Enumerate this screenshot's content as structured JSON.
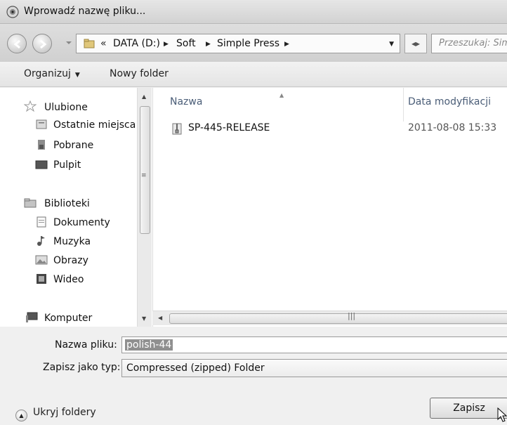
{
  "window": {
    "title": "Wprowadź nazwę pliku..."
  },
  "address": {
    "overflow": "«",
    "crumbs": [
      "DATA (D:)",
      "Soft",
      "Simple Press"
    ],
    "search_placeholder": "Przeszukaj: Sim"
  },
  "toolbar": {
    "organize_label": "Organizuj",
    "new_folder_label": "Nowy folder"
  },
  "nav": {
    "favorites_label": "Ulubione",
    "favorites": [
      "Ostatnie miejsca",
      "Pobrane",
      "Pulpit"
    ],
    "libraries_label": "Biblioteki",
    "libraries": [
      "Dokumenty",
      "Muzyka",
      "Obrazy",
      "Wideo"
    ],
    "computer_label": "Komputer"
  },
  "files": {
    "columns": {
      "name": "Nazwa",
      "modified": "Data modyfikacji"
    },
    "rows": [
      {
        "name": "SP-445-RELEASE",
        "modified": "2011-08-08 15:33"
      }
    ]
  },
  "form": {
    "filename_label": "Nazwa pliku:",
    "filename_value": "polish-44",
    "type_label": "Zapisz jako typ:",
    "type_value": "Compressed (zipped) Folder",
    "hide_folders_label": "Ukryj foldery",
    "save_label": "Zapisz"
  },
  "icons": {
    "app": "dialog-icon",
    "back": "back-arrow-icon",
    "forward": "forward-arrow-icon",
    "refresh": "refresh-icon",
    "favorites": "star-icon",
    "folder": "folder-icon"
  }
}
